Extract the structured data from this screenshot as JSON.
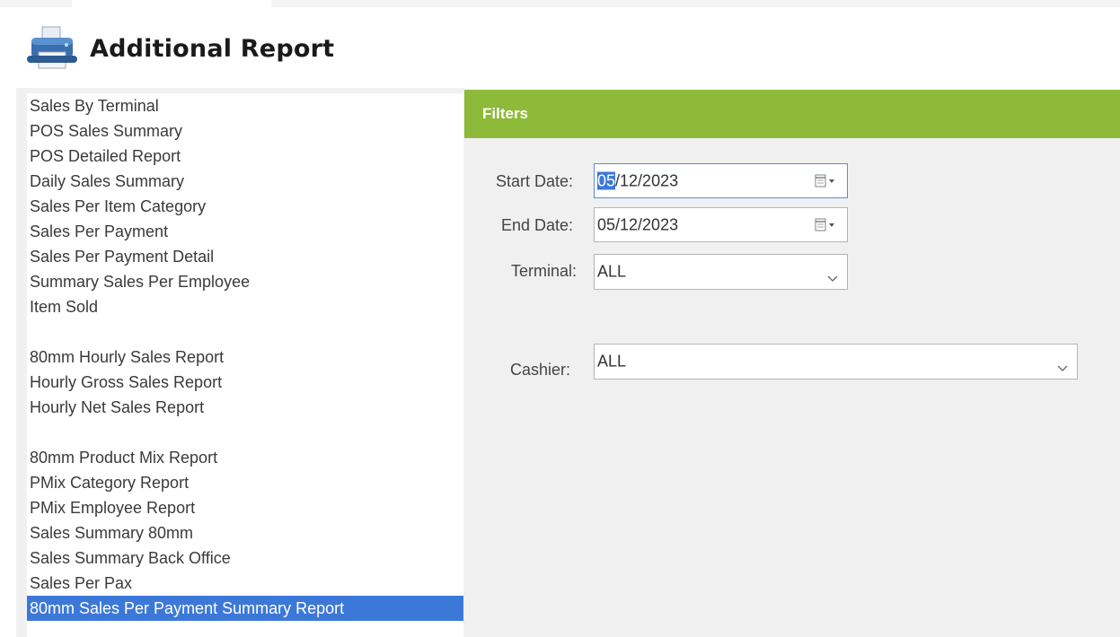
{
  "header": {
    "title": "Additional Report",
    "icon": "printer-icon"
  },
  "reports": {
    "group1": [
      "Sales By Terminal",
      "POS Sales Summary",
      "POS Detailed Report",
      "Daily Sales Summary",
      "Sales Per Item Category",
      "Sales Per Payment",
      "Sales Per Payment Detail",
      "Summary Sales Per Employee",
      "Item Sold"
    ],
    "group2": [
      "80mm Hourly Sales Report",
      "Hourly Gross Sales Report",
      "Hourly Net Sales Report"
    ],
    "group3": [
      "80mm Product Mix Report",
      "PMix Category Report",
      "PMix Employee Report",
      "Sales Summary 80mm",
      "Sales Summary Back Office",
      "Sales Per Pax",
      "80mm Sales Per Payment Summary Report"
    ],
    "selected": "80mm Sales Per Payment Summary Report"
  },
  "filters": {
    "title": "Filters",
    "start_date": {
      "label": "Start Date:",
      "value_selected": "05",
      "value_rest": "/12/2023"
    },
    "end_date": {
      "label": "End Date:",
      "value": "05/12/2023"
    },
    "terminal": {
      "label": "Terminal:",
      "value": "ALL"
    },
    "cashier": {
      "label": "Cashier:",
      "value": "ALL"
    }
  },
  "colors": {
    "accent_green": "#8dba38",
    "selection_blue": "#3c78d8"
  }
}
